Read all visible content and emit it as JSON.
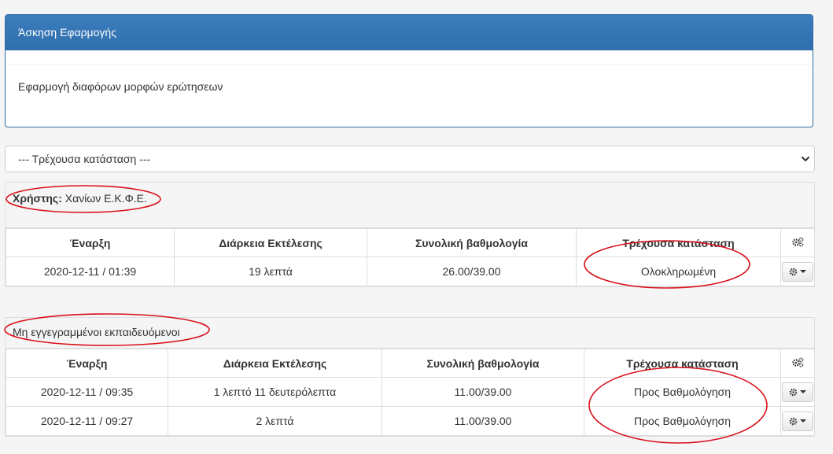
{
  "exercise": {
    "title": "Άσκηση Εφαρμογής",
    "description": "Εφαρμογή διαφόρων μορφών ερώτησεων"
  },
  "status_filter": {
    "selected": "--- Τρέχουσα κατάσταση ---"
  },
  "user_panel": {
    "user_label": "Χρήστης:",
    "user_name": "Χανίων Ε.Κ.Φ.Ε.",
    "columns": {
      "start": "Έναρξη",
      "duration": "Διάρκεια Εκτέλεσης",
      "score": "Συνολική βαθμολογία",
      "status": "Τρέχουσα κατάσταση"
    },
    "rows": [
      {
        "start": "2020-12-11 / 01:39",
        "duration": "19 λεπτά",
        "score": "26.00/39.00",
        "status": "Ολοκληρωμένη"
      }
    ]
  },
  "unregistered_panel": {
    "title": "Μη εγγεγραμμένοι εκπαιδευόμενοι",
    "columns": {
      "start": "Έναρξη",
      "duration": "Διάρκεια Εκτέλεσης",
      "score": "Συνολική βαθμολογία",
      "status": "Τρέχουσα κατάσταση"
    },
    "rows": [
      {
        "start": "2020-12-11 / 09:35",
        "duration": "1 λεπτό 11 δευτερόλεπτα",
        "score": "11.00/39.00",
        "status": "Προς Βαθμολόγηση"
      },
      {
        "start": "2020-12-11 / 09:27",
        "duration": "2 λεπτά",
        "score": "11.00/39.00",
        "status": "Προς Βαθμολόγηση"
      }
    ]
  },
  "icons": {
    "settings_header": "cogs-icon",
    "row_action": "cog-icon",
    "select_arrow": "chevron-down-icon"
  },
  "colors": {
    "panel_primary": "#337ab7",
    "link_green": "#3a7c74",
    "annotation_red": "#d9101a"
  }
}
